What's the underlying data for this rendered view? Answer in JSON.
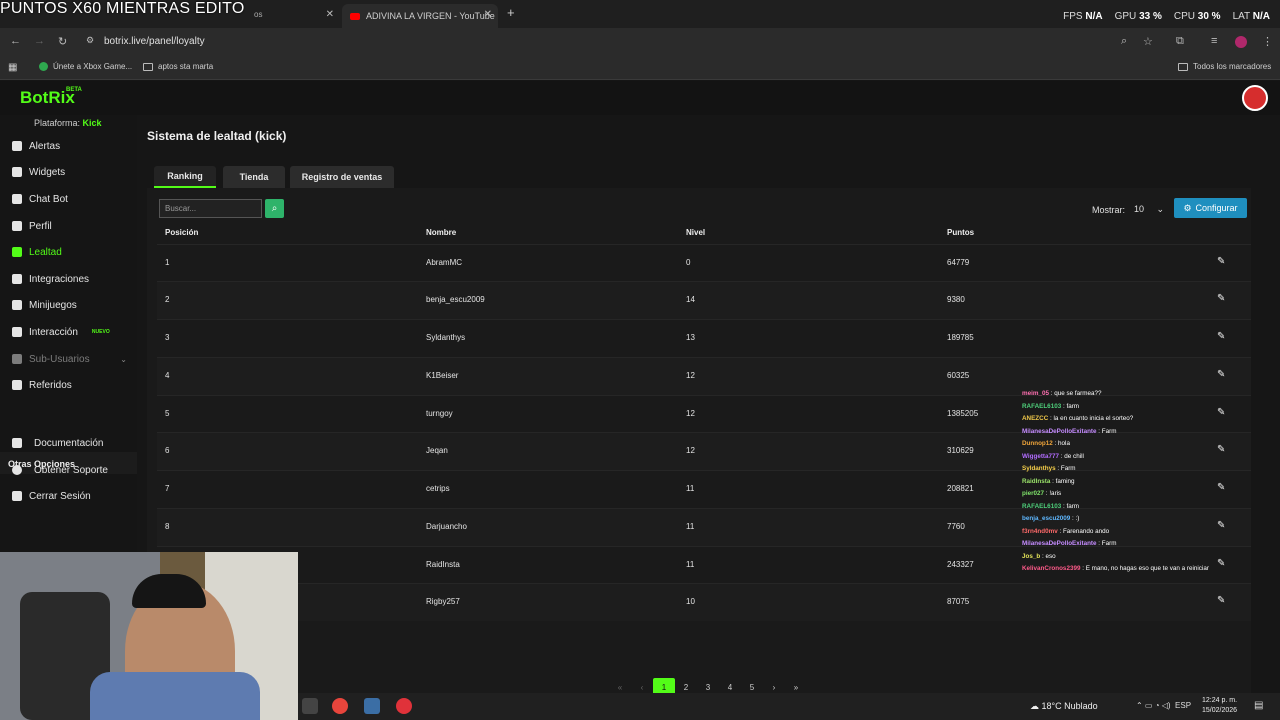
{
  "browser": {
    "overlay_title": "PUNTOS X60 MIENTRAS EDITO",
    "tab1_suffix": "os",
    "tab2_title": "ADIVINA LA VIRGEN - YouTube",
    "new_tab": "+",
    "hud": {
      "fps_label": "FPS",
      "fps": "N/A",
      "gpu_label": "GPU",
      "gpu": "33 %",
      "cpu_label": "CPU",
      "cpu": "30 %",
      "lat_label": "LAT",
      "lat": "N/A"
    },
    "url": "botrix.live/panel/loyalty",
    "bookmarks": [
      "Únete a Xbox Game...",
      "aptos sta marta"
    ],
    "all_bookmarks": "Todos los marcadores"
  },
  "app": {
    "logo": "BotRix",
    "beta": "BETA",
    "platform_label": "Plataforma:",
    "platform_value": "Kick",
    "nav": [
      "Alertas",
      "Widgets",
      "Chat Bot",
      "Perfil",
      "Lealtad",
      "Integraciones",
      "Minijuegos",
      "Interacción",
      "Sub-Usuarios",
      "Referidos"
    ],
    "nav_new_badge": "NUEVO",
    "other_section": "Otras Opciones",
    "other_nav": [
      "Documentación",
      "Obtener Soporte",
      "Cerrar Sesión"
    ],
    "page_title": "Sistema de lealtad (kick)",
    "tabs": [
      "Ranking",
      "Tienda",
      "Registro de ventas"
    ],
    "search_placeholder": "Buscar...",
    "show_label": "Mostrar:",
    "show_value": "10",
    "configure": "Configurar",
    "columns": [
      "Posición",
      "Nombre",
      "Nivel",
      "Puntos"
    ],
    "rows": [
      {
        "pos": "1",
        "name": "AbramMC",
        "level": "0",
        "points": "64779"
      },
      {
        "pos": "2",
        "name": "benja_escu2009",
        "level": "14",
        "points": "9380"
      },
      {
        "pos": "3",
        "name": "Syldanthys",
        "level": "13",
        "points": "189785"
      },
      {
        "pos": "4",
        "name": "K1Beiser",
        "level": "12",
        "points": "60325"
      },
      {
        "pos": "5",
        "name": "turngoy",
        "level": "12",
        "points": "1385205"
      },
      {
        "pos": "6",
        "name": "Jeqan",
        "level": "12",
        "points": "310629"
      },
      {
        "pos": "7",
        "name": "cetrips",
        "level": "11",
        "points": "208821"
      },
      {
        "pos": "8",
        "name": "Darjuancho",
        "level": "11",
        "points": "7760"
      },
      {
        "pos": "",
        "name": "RaidInsta",
        "level": "11",
        "points": "243327"
      },
      {
        "pos": "",
        "name": "Rigby257",
        "level": "10",
        "points": "87075"
      }
    ],
    "pagination": [
      "«",
      "‹",
      "1",
      "2",
      "3",
      "4",
      "5",
      "›",
      "»"
    ]
  },
  "chat": [
    {
      "user": "meim_05",
      "color": "#ff6fb1",
      "text": "que se farmea??"
    },
    {
      "user": "RAFAEL6103",
      "color": "#4fd17c",
      "text": "farm"
    },
    {
      "user": "ANEZCC",
      "color": "#f0c84a",
      "text": "la en cuanto inicia el sorteo?"
    },
    {
      "user": "MilanesaDePolloExitante",
      "color": "#c58cff",
      "text": "Farm"
    },
    {
      "user": "Dunnop12",
      "color": "#f0a53a",
      "text": "hola"
    },
    {
      "user": "Wiggetta777",
      "color": "#b26cff",
      "text": "de chill"
    },
    {
      "user": "Syldanthys",
      "color": "#f7d04a",
      "text": "Farm"
    },
    {
      "user": "RaidInsta",
      "color": "#9be36a",
      "text": "faming"
    },
    {
      "user": "pier027",
      "color": "#7fe36a",
      "text": "!aris"
    },
    {
      "user": "RAFAEL6103",
      "color": "#4fd17c",
      "text": "farm"
    },
    {
      "user": "benja_escu2009",
      "color": "#5fb8ff",
      "text": ":)"
    },
    {
      "user": "f3rn4nd0mv",
      "color": "#ff6a6a",
      "text": "Farenando ando"
    },
    {
      "user": "MilanesaDePolloExitante",
      "color": "#c58cff",
      "text": "Farm"
    },
    {
      "user": "Jos_b",
      "color": "#e6e65a",
      "text": "eso"
    },
    {
      "user": "KelivanCronos2399",
      "color": "#ff5a8a",
      "text": "E mano, no hagas eso que te van a reiniciar"
    }
  ],
  "taskbar": {
    "weather": "18°C Nublado",
    "lang": "ESP",
    "time": "12:24 p. m.",
    "date": "15/02/2026"
  },
  "colors": {
    "accent": "#53fc18",
    "button_blue": "#1f8fbf",
    "search_green": "#2eb36a"
  }
}
